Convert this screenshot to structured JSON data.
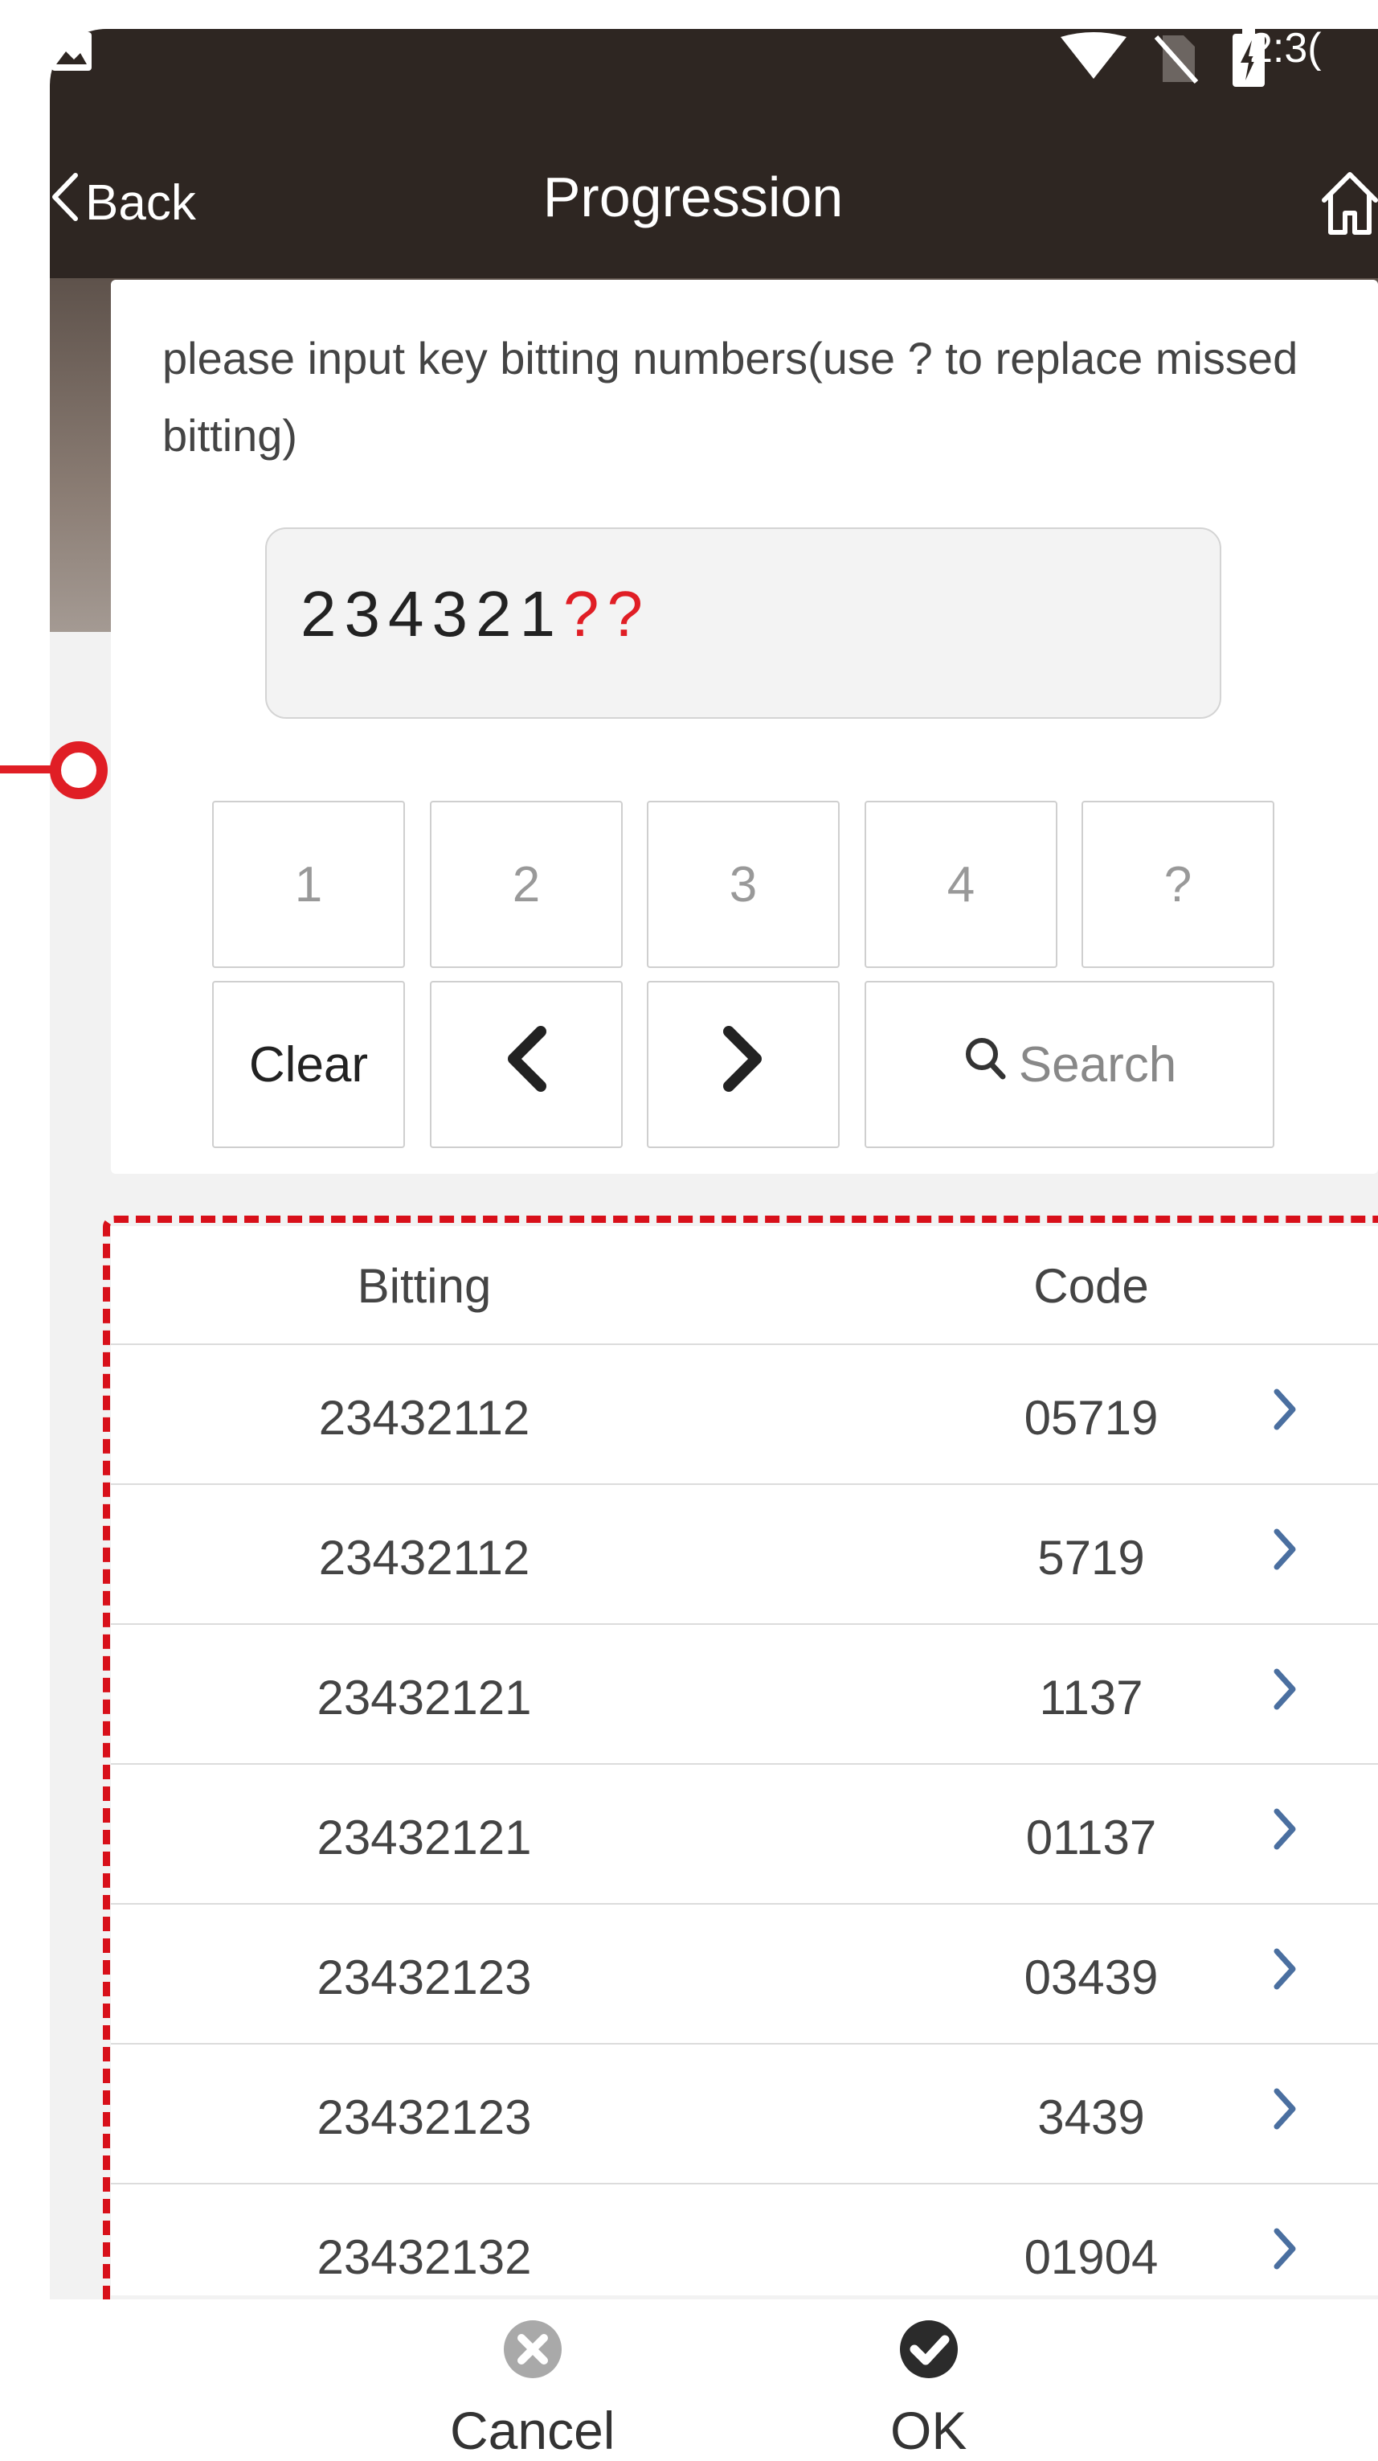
{
  "status_bar": {
    "time": "2:3(",
    "icons": [
      "image-icon",
      "wifi-icon",
      "no-sim-icon",
      "battery-charging-icon"
    ]
  },
  "header": {
    "back_label": "Back",
    "title": "Progression"
  },
  "dialog": {
    "prompt": "please input key bitting numbers(use ? to replace missed bitting)",
    "bitting_known": "234321",
    "bitting_missing": "??",
    "keys": [
      "1",
      "2",
      "3",
      "4",
      "?"
    ],
    "clear_label": "Clear",
    "search_label": "Search"
  },
  "table": {
    "columns": [
      "Bitting",
      "Code"
    ],
    "rows": [
      {
        "bitting": "23432112",
        "code": "05719"
      },
      {
        "bitting": "23432112",
        "code": "5719"
      },
      {
        "bitting": "23432121",
        "code": "1137"
      },
      {
        "bitting": "23432121",
        "code": "01137"
      },
      {
        "bitting": "23432123",
        "code": "03439"
      },
      {
        "bitting": "23432123",
        "code": "3439"
      },
      {
        "bitting": "23432132",
        "code": "01904"
      }
    ]
  },
  "footer": {
    "cancel_label": "Cancel",
    "ok_label": "OK"
  },
  "colors": {
    "appbar": "#2e2622",
    "annotation_red": "#d8101a",
    "missing_red": "#e01e25"
  }
}
